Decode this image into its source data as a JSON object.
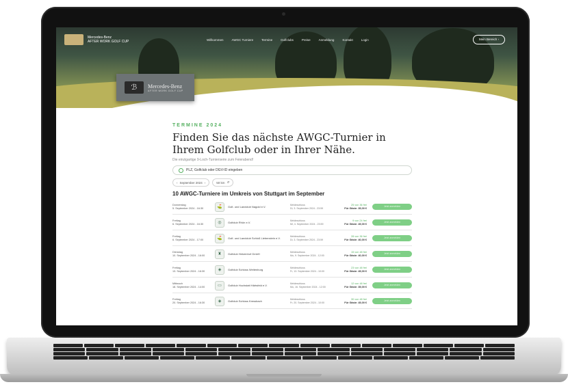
{
  "header": {
    "brand_line1": "Mercedes-Benz",
    "brand_line2": "AFTER WORK GOLF CUP",
    "nav": [
      "Willkommen",
      "AWGC Turniere",
      "Termine",
      "Golfclubs",
      "Preise",
      "Anmeldung",
      "Kontakt",
      "Login"
    ],
    "account_button": "Mein Bereich",
    "badge_name": "Mercedes-Benz",
    "badge_sub": "AFTER WORK GOLF CUP"
  },
  "main": {
    "eyebrow": "TERMINE 2024",
    "headline": "Finden Sie das nächste AWGC-Turnier in Ihrem Golfclub oder in Ihrer Nähe.",
    "lead": "Die einzigartige 9-Loch-Turnierserie zum Feierabend!",
    "search": {
      "value": "PLZ, Golfclub oder DGV-ID eingeben",
      "placeholder": "PLZ, Golfclub oder DGV-ID eingeben"
    },
    "filters": {
      "month": "September 2024",
      "radius": "50 km"
    },
    "results_title": "10 AWGC-Turniere im Umkreis von Stuttgart im September"
  },
  "events": [
    {
      "day": "Donnerstag",
      "date": "5. September 2024 - 16:30",
      "club": "Golf- und Landclub Nagold e.V.",
      "close_label": "Meldeschluss",
      "close": "Di, 3. September 2024 - 23:59",
      "free": "25 von 36 frei",
      "fee": "Für Gäste: 35,00 €",
      "button": "Jetzt anmelden"
    },
    {
      "day": "Freitag",
      "date": "6. September 2024 - 16:30",
      "club": "Golfclub Rhön e.V.",
      "close_label": "Meldeschluss",
      "close": "Mi, 4. September 2024 - 23:59",
      "free": "9 von 24 frei",
      "fee": "Für Gäste: 45,00 €",
      "button": "Jetzt anmelden"
    },
    {
      "day": "Freitag",
      "date": "6. September 2024 - 17:00",
      "club": "Golf- und Landclub Schloß Liebenstein e.V.",
      "close_label": "Meldeschluss",
      "close": "Di, 3. September 2024 - 23:59",
      "free": "28 von 36 frei",
      "fee": "Für Gäste: 40,00 €",
      "button": "Jetzt anmelden"
    },
    {
      "day": "Dienstag",
      "date": "10. September 2024 - 16:00",
      "club": "Golfclub Hetzenhof GmbH",
      "close_label": "Meldeschluss",
      "close": "Mo, 9. September 2024 - 12:00",
      "free": "15 von 48 frei",
      "fee": "Für Gäste: 40,00 €",
      "button": "Jetzt anmelden"
    },
    {
      "day": "Freitag",
      "date": "13. September 2024 - 16:30",
      "club": "Golfclub Schloss Weitenburg",
      "close_label": "Meldeschluss",
      "close": "Fr, 13. September 2024 - 10:00",
      "free": "23 von 48 frei",
      "fee": "Für Gäste: 45,00 €",
      "button": "Jetzt anmelden"
    },
    {
      "day": "Mittwoch",
      "date": "18. September 2024 - 14:00",
      "club": "Golfclub Hochstatt Härtsfeld e.V.",
      "close_label": "Meldeschluss",
      "close": "Mo, 16. September 2024 - 12:00",
      "free": "12 von 48 frei",
      "fee": "Für Gäste: 35,00 €",
      "button": "Jetzt anmelden"
    },
    {
      "day": "Freitag",
      "date": "20. September 2024 - 16:30",
      "club": "Golfclub Schloss Kressbach",
      "close_label": "Meldeschluss",
      "close": "Fr, 20. September 2024 - 10:00",
      "free": "30 von 48 frei",
      "fee": "Für Gäste: 45,00 €",
      "button": "Jetzt anmelden"
    }
  ]
}
